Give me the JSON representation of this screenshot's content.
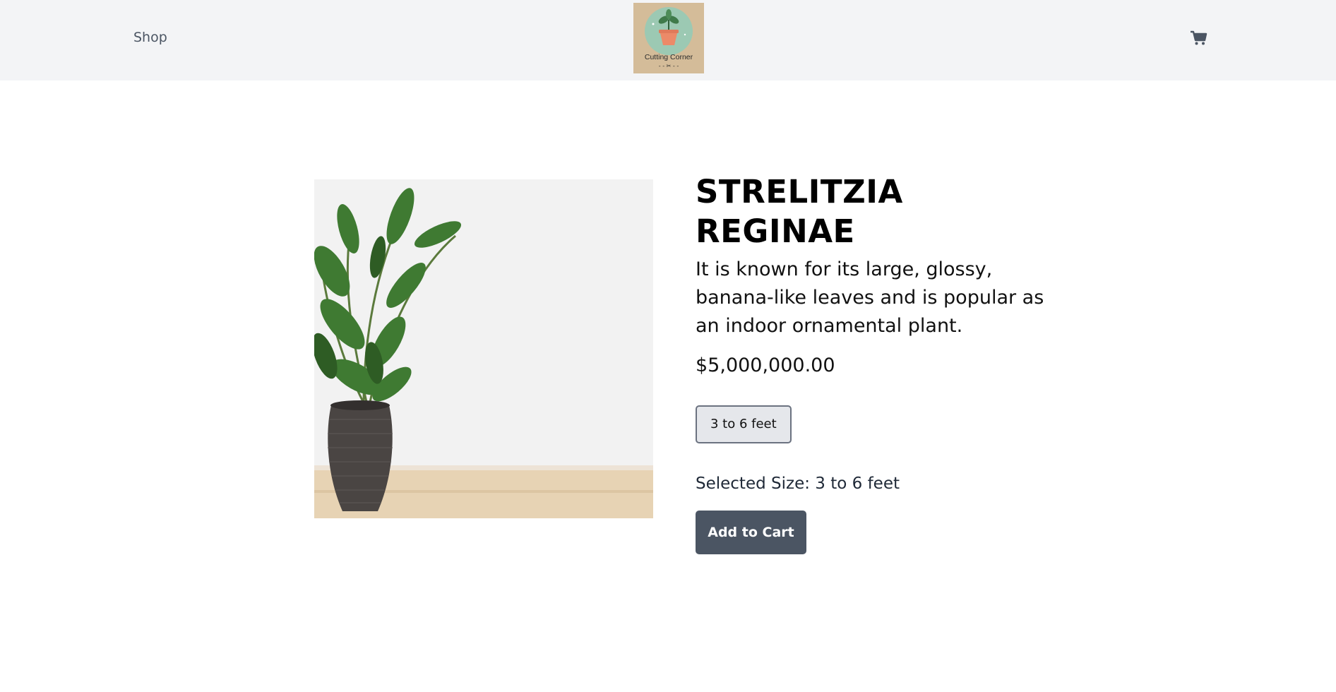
{
  "nav": {
    "shop_label": "Shop",
    "logo_text": "Cutting Corner",
    "cart_icon": "shopping-cart-icon"
  },
  "product": {
    "title": "STRELITZIA REGINAE",
    "description": "It is known for its large, glossy, banana-like leaves and is popular as an indoor ornamental plant.",
    "price": "$5,000,000.00",
    "size_options": [
      "3 to 6 feet"
    ],
    "selected_size": "Selected Size: 3 to 6 feet",
    "add_to_cart_label": "Add to Cart"
  },
  "colors": {
    "navbar_bg": "#f3f4f6",
    "button_bg": "#4b5563",
    "size_option_bg": "#e5e7eb",
    "size_option_border": "#6b7280",
    "logo_bg": "#d4bc99"
  }
}
